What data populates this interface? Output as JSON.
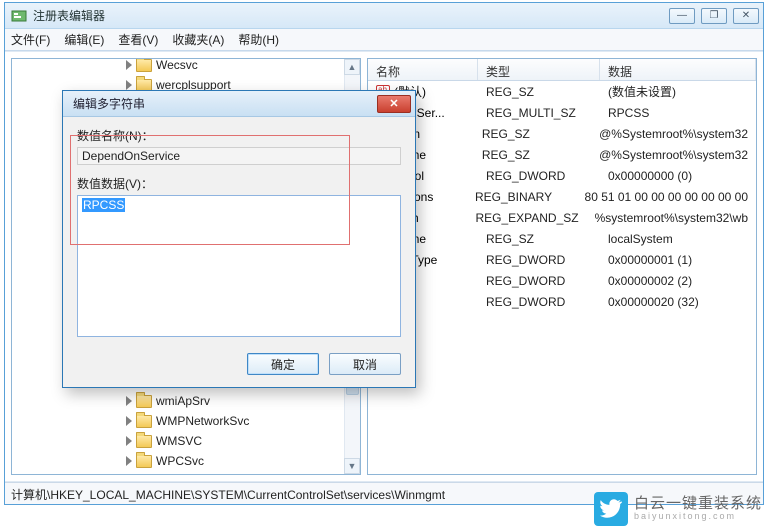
{
  "window": {
    "title": "注册表编辑器",
    "buttons": {
      "min": "—",
      "max": "❐",
      "close": "✕"
    }
  },
  "menu": {
    "file": "文件(F)",
    "edit": "编辑(E)",
    "view": "查看(V)",
    "fav": "收藏夹(A)",
    "help": "帮助(H)"
  },
  "tree": {
    "top": [
      {
        "indent": 112,
        "label": "Wecsvc"
      },
      {
        "indent": 112,
        "label": "wercplsupport"
      }
    ],
    "bottom": [
      {
        "indent": 112,
        "label": "wmiApSrv"
      },
      {
        "indent": 112,
        "label": "WMPNetworkSvc"
      },
      {
        "indent": 112,
        "label": "WMSVC"
      },
      {
        "indent": 112,
        "label": "WPCSvc"
      }
    ]
  },
  "list": {
    "headers": {
      "name": "名称",
      "type": "类型",
      "data": "数据"
    },
    "rows": [
      {
        "icon": "str",
        "name": "(默认)",
        "type": "REG_SZ",
        "data": "(数值未设置)"
      },
      {
        "icon": "str",
        "name": "dOnSer...",
        "type": "REG_MULTI_SZ",
        "data": "RPCSS"
      },
      {
        "icon": "str",
        "name": "ption",
        "type": "REG_SZ",
        "data": "@%Systemroot%\\system32"
      },
      {
        "icon": "str",
        "name": "Name",
        "type": "REG_SZ",
        "data": "@%Systemroot%\\system32"
      },
      {
        "icon": "bin",
        "name": "ontrol",
        "type": "REG_DWORD",
        "data": "0x00000000 (0)"
      },
      {
        "icon": "bin",
        "name": "Actions",
        "type": "REG_BINARY",
        "data": "80 51 01 00 00 00 00 00 00 00"
      },
      {
        "icon": "str",
        "name": "Path",
        "type": "REG_EXPAND_SZ",
        "data": "%systemroot%\\system32\\wb"
      },
      {
        "icon": "str",
        "name": "Name",
        "type": "REG_SZ",
        "data": "localSystem"
      },
      {
        "icon": "bin",
        "name": "SidType",
        "type": "REG_DWORD",
        "data": "0x00000001 (1)"
      },
      {
        "icon": "bin",
        "name": "",
        "type": "REG_DWORD",
        "data": "0x00000002 (2)"
      },
      {
        "icon": "bin",
        "name": "",
        "type": "REG_DWORD",
        "data": "0x00000020 (32)"
      }
    ]
  },
  "statusbar": "计算机\\HKEY_LOCAL_MACHINE\\SYSTEM\\CurrentControlSet\\services\\Winmgmt",
  "dialog": {
    "title": "编辑多字符串",
    "nameLabel": "数值名称(N)：",
    "nameValue": "DependOnService",
    "dataLabel": "数值数据(V)：",
    "dataValue": "RPCSS",
    "ok": "确定",
    "cancel": "取消"
  },
  "watermark": {
    "big": "白云一键重装系统",
    "small": "baiyunxitong.com"
  },
  "chart_data": null
}
